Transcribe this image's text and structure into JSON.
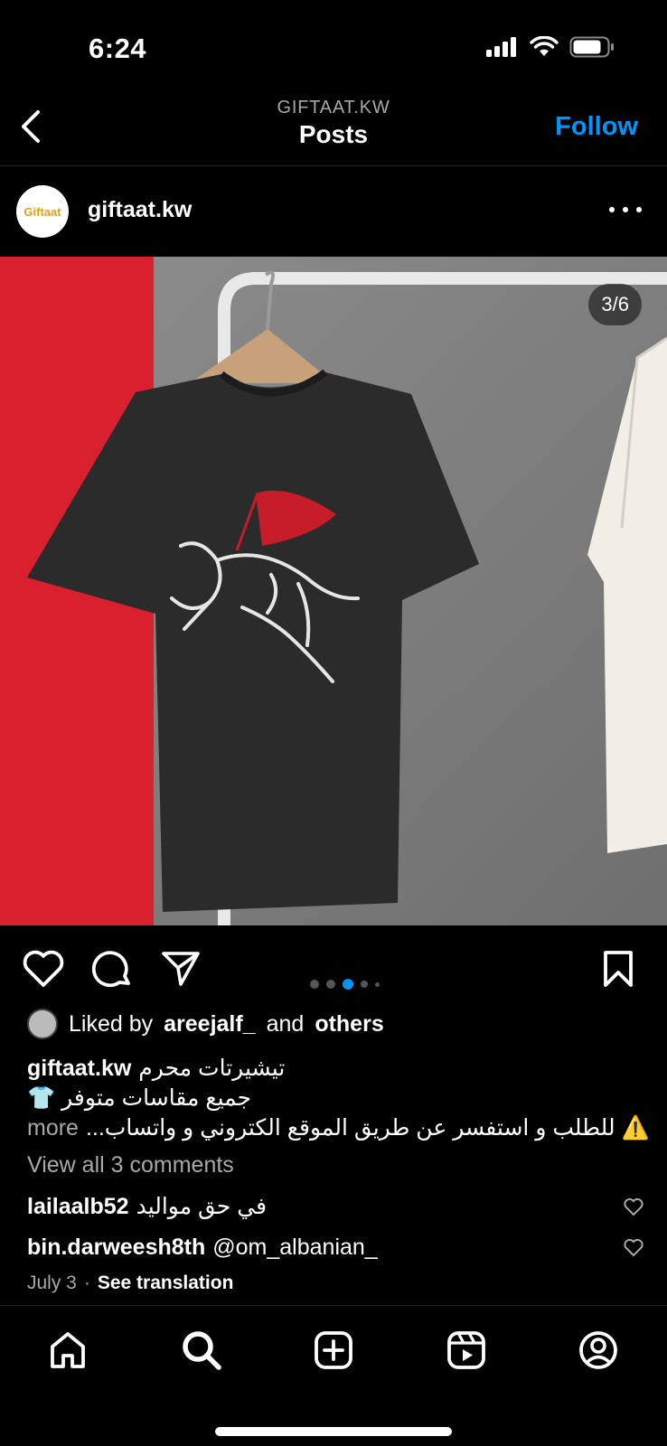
{
  "status_bar": {
    "time": "6:24"
  },
  "header": {
    "account": "GIFTAAT.KW",
    "title": "Posts",
    "follow": "Follow"
  },
  "post": {
    "avatar_text": "Giftaat",
    "username": "giftaat.kw",
    "image_counter": "3/6",
    "carousel": {
      "total_dots": 5,
      "active_index": 2
    },
    "liked": {
      "prefix": "Liked by",
      "user": "areejalf_",
      "and": "and",
      "others": "others"
    },
    "caption": {
      "user": "giftaat.kw",
      "line1": "تيشيرتات محرم",
      "line2": "جميع مقاسات متوفر 👕",
      "line3": "⚠️ للطلب و استفسر عن طريق الموقع الكتروني و واتساب...",
      "more": "more"
    },
    "view_comments": "View all 3 comments",
    "comments": [
      {
        "user": "lailaalb52",
        "text": "في حق مواليد"
      },
      {
        "user": "bin.darweesh8th",
        "text": "@om_albanian_"
      }
    ],
    "date": "July 3",
    "separator": "·",
    "see_translation": "See translation"
  },
  "colors": {
    "accent": "#0095f6",
    "background": "#000000",
    "muted": "#a8a8a8",
    "flag_red": "#d8202f"
  }
}
